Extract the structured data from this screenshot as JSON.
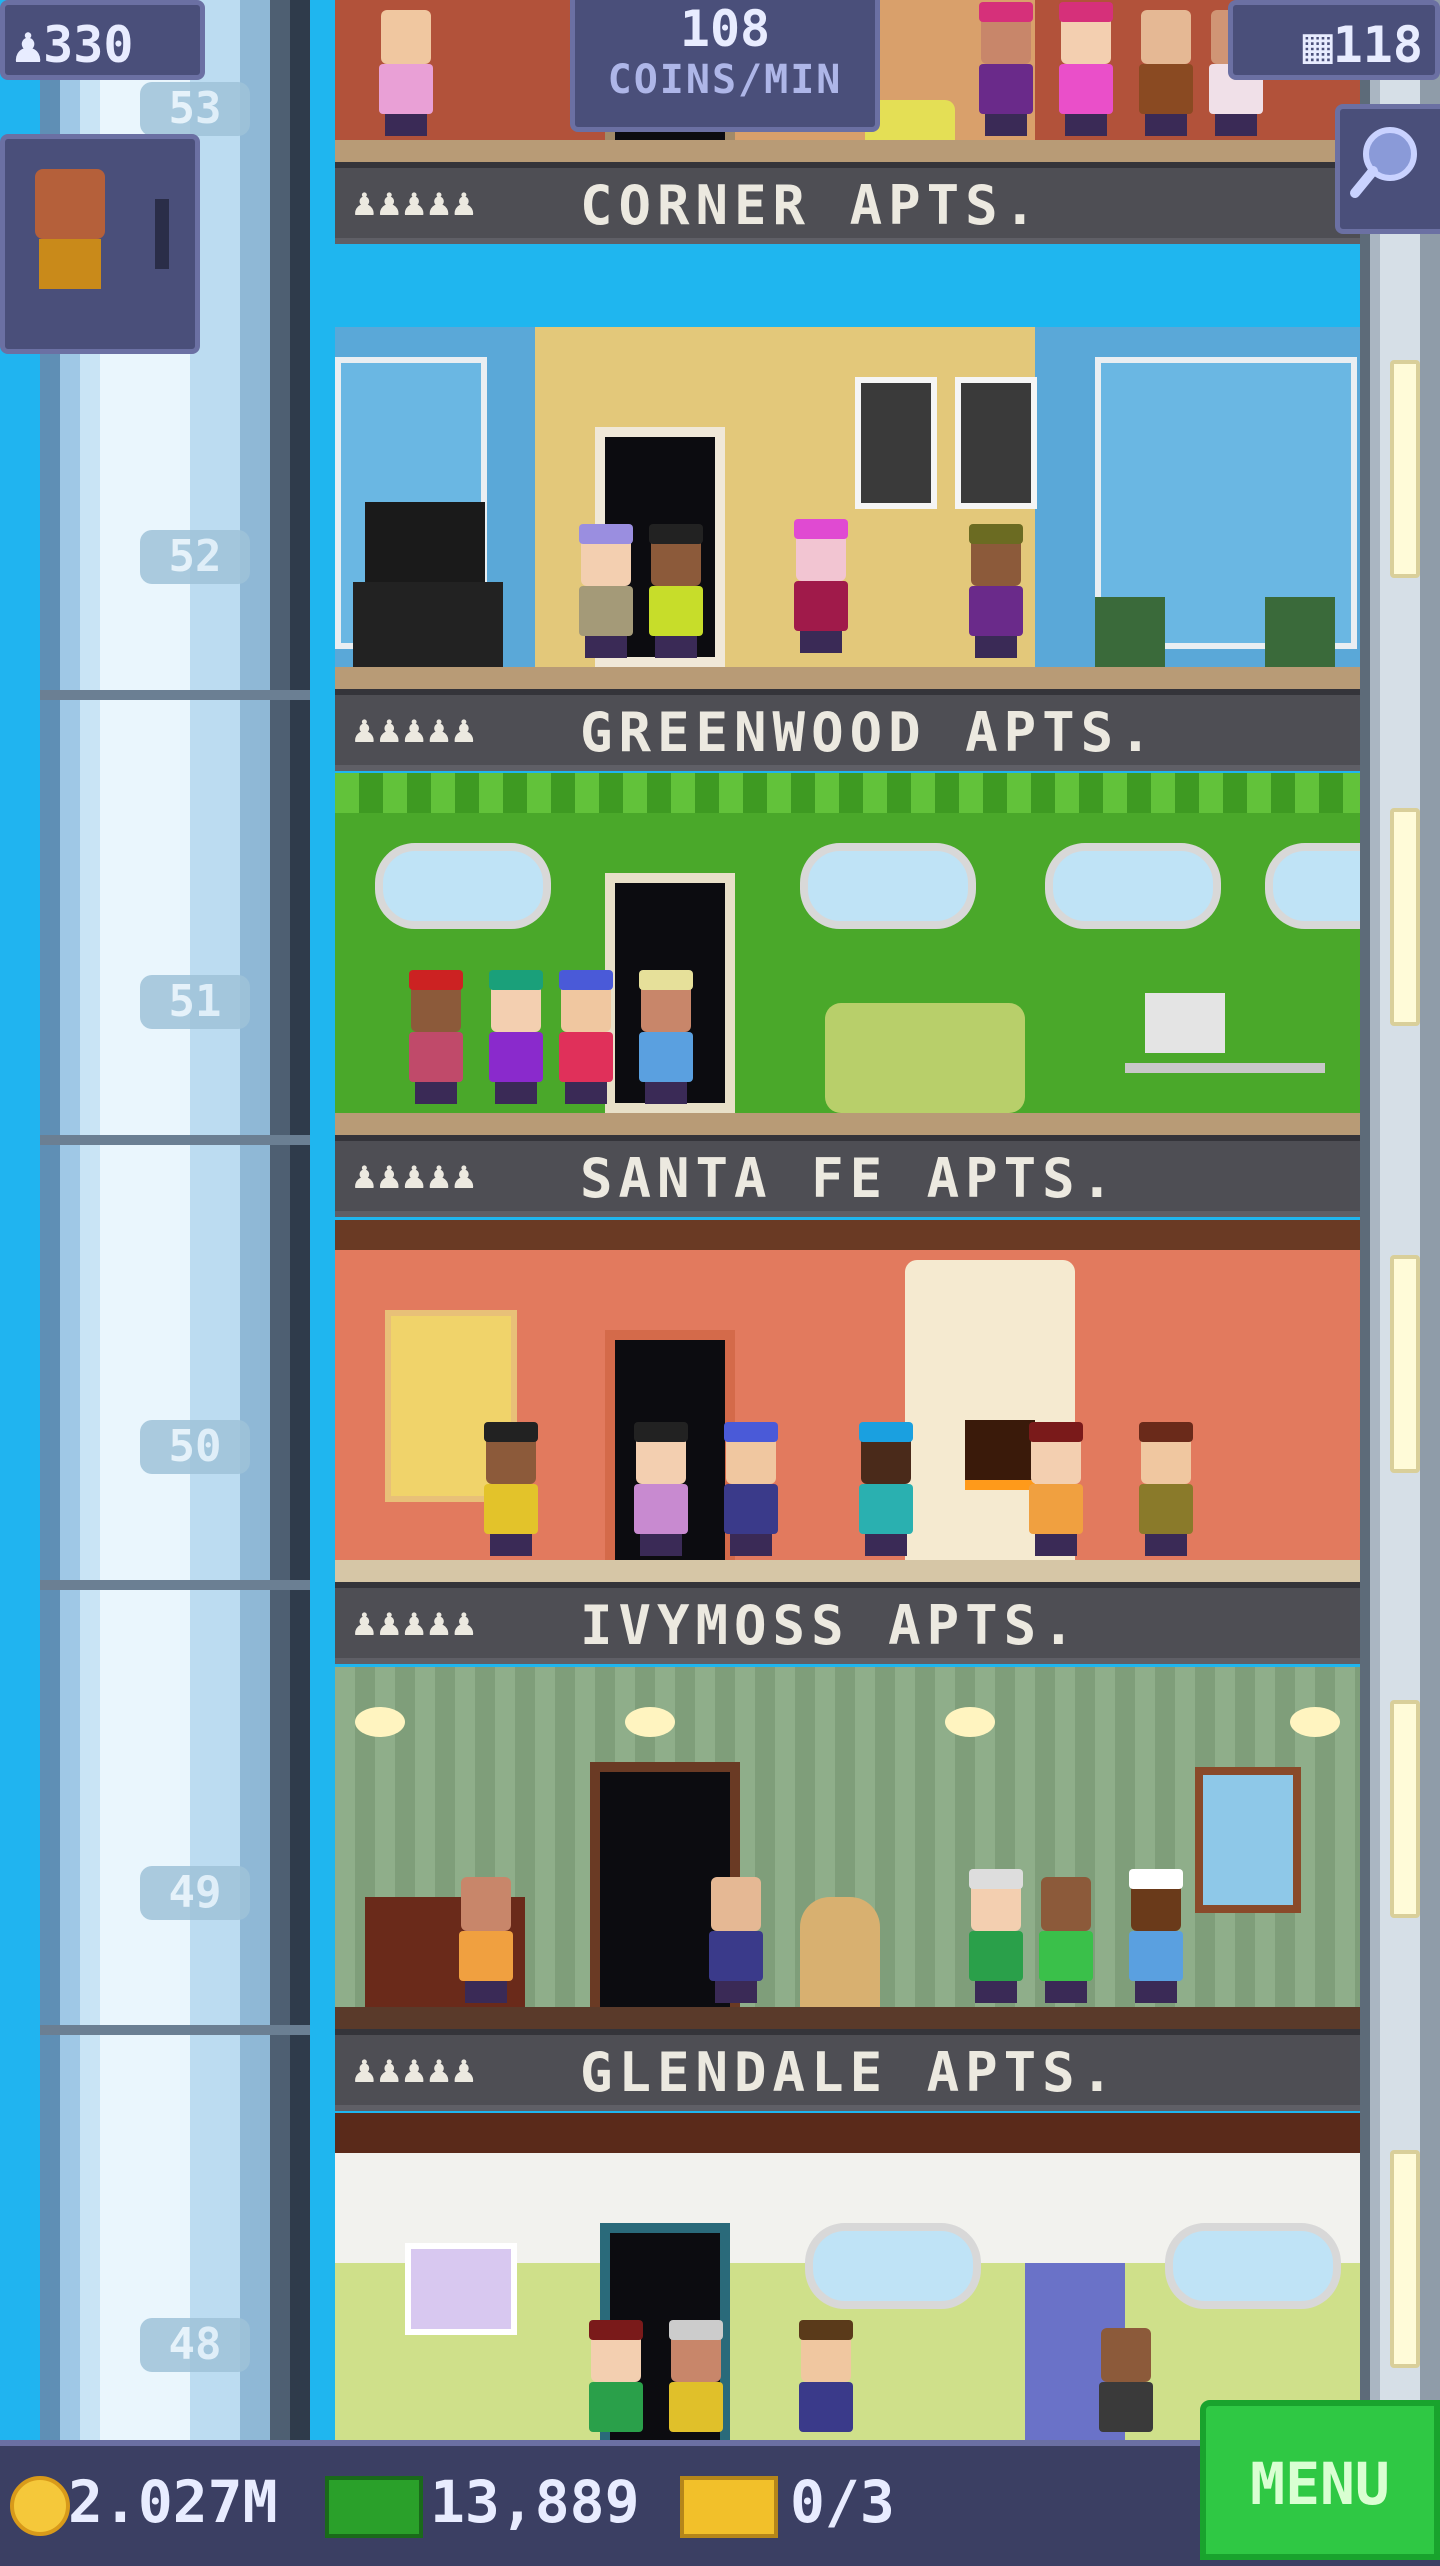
{
  "hud": {
    "population": "330",
    "coins_per_min": "108",
    "coins_per_min_unit": "COINS/MIN",
    "floors": "118"
  },
  "floors": [
    {
      "number": "53",
      "name": "CORNER APTS.",
      "dots": "♟♟♟♟♟"
    },
    {
      "number": "52",
      "name": "GREENWOOD APTS.",
      "dots": "♟♟♟♟♟"
    },
    {
      "number": "51",
      "name": "SANTA FE APTS.",
      "dots": "♟♟♟♟♟"
    },
    {
      "number": "50",
      "name": "IVYMOSS APTS.",
      "dots": "♟♟♟♟♟"
    },
    {
      "number": "49",
      "name": "GLENDALE APTS.",
      "dots": "♟♟♟♟♟"
    },
    {
      "number": "48",
      "name": "",
      "dots": ""
    }
  ],
  "bottom_bar": {
    "coins": "2.027M",
    "bux": "13,889",
    "tickets": "0/3",
    "menu_label": "MENU"
  },
  "icons": {
    "population": "person-icon",
    "floors": "building-icon",
    "search": "magnifier-icon",
    "coin": "coin-icon",
    "bux": "cash-icon",
    "ticket": "ticket-icon"
  },
  "colors": {
    "hud_bg": "#4a4f7a",
    "menu_green": "#2fc844",
    "sky": "#20b4f0"
  }
}
